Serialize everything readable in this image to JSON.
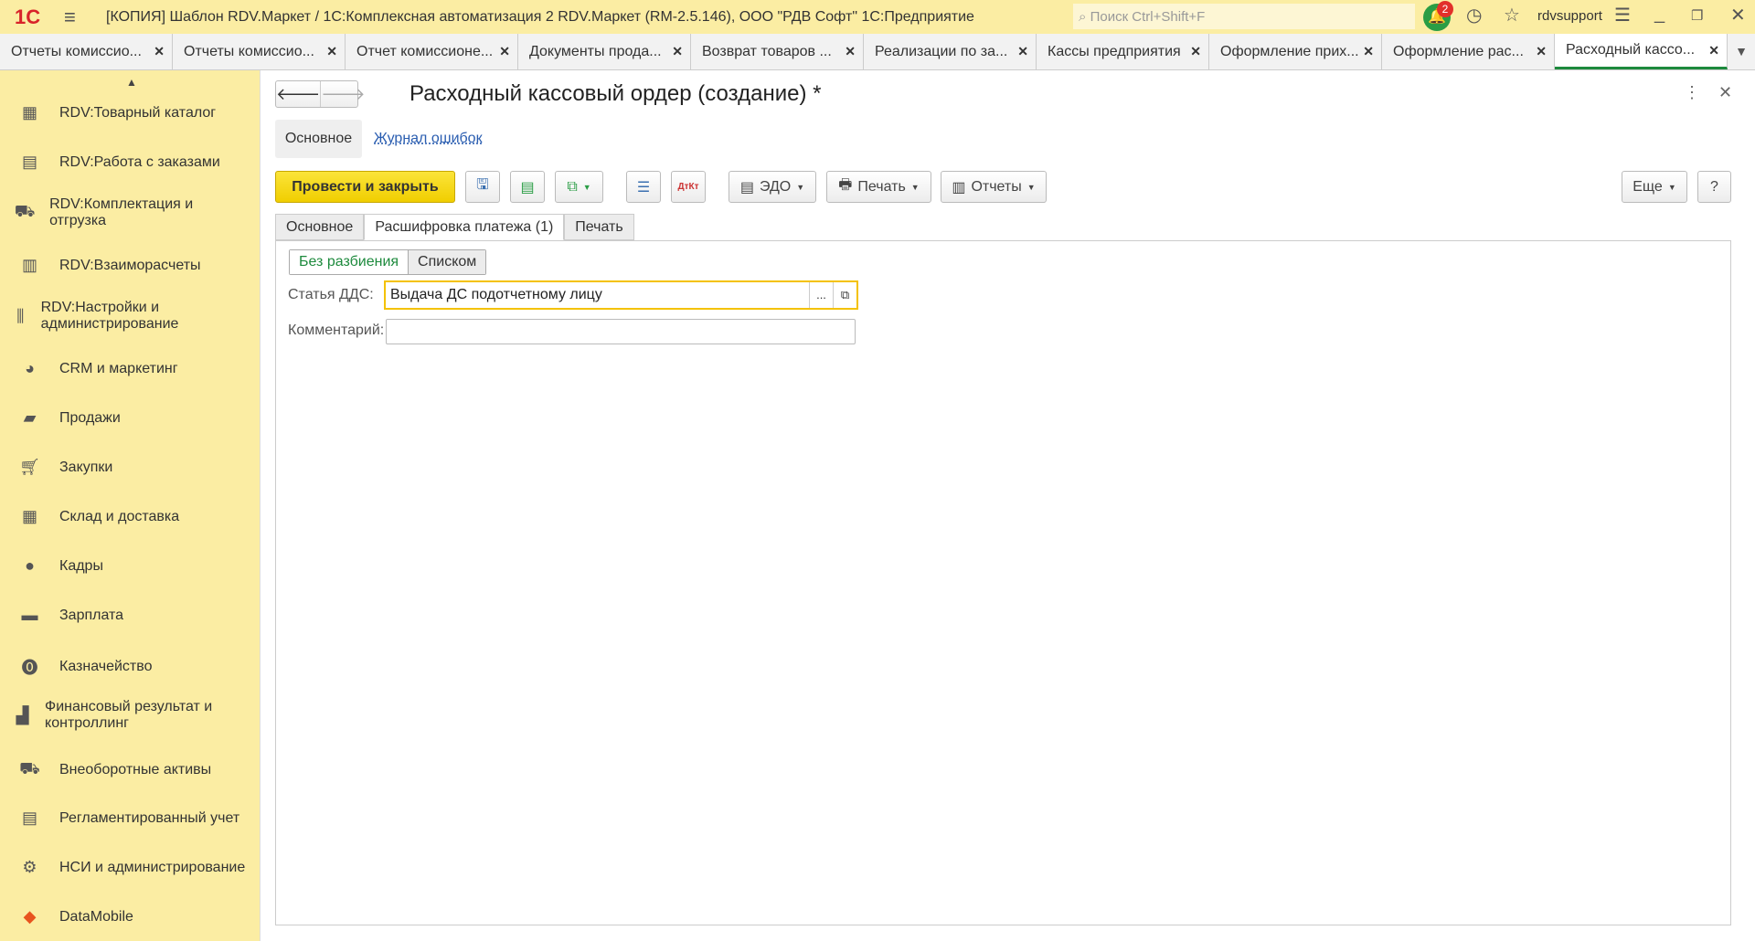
{
  "titlebar": {
    "logo": "1С",
    "title": "[КОПИЯ] Шаблон RDV.Маркет / 1С:Комплексная автоматизация 2 RDV.Маркет (RM-2.5.146), ООО \"РДВ Софт\" 1С:Предприятие",
    "search_placeholder": "Поиск Ctrl+Shift+F",
    "notifications": "2",
    "user": "rdvsupport"
  },
  "open_tabs": [
    "Отчеты комиссио...",
    "Отчеты комиссио...",
    "Отчет комиссионе...",
    "Документы прода...",
    "Возврат товаров ...",
    "Реализации по за...",
    "Кассы предприятия",
    "Оформление прих...",
    "Оформление рас...",
    "Расходный кассо..."
  ],
  "sidebar": [
    "RDV:Товарный каталог",
    "RDV:Работа с заказами",
    "RDV:Комплектация и отгрузка",
    "RDV:Взаиморасчеты",
    "RDV:Настройки и администрирование",
    "CRM и маркетинг",
    "Продажи",
    "Закупки",
    "Склад и доставка",
    "Кадры",
    "Зарплата",
    "Казначейство",
    "Финансовый результат и контроллинг",
    "Внеоборотные активы",
    "Регламентированный учет",
    "НСИ и администрирование",
    "DataMobile"
  ],
  "form": {
    "title": "Расходный кассовый ордер (создание) *",
    "nav_main": "Основное",
    "nav_errors": "Журнал ошибок",
    "toolbar": {
      "post_close": "Провести и закрыть",
      "edo": "ЭДО",
      "print": "Печать",
      "reports": "Отчеты",
      "more": "Еще",
      "help": "?",
      "dtkt": "ДтКт"
    },
    "tabs": [
      "Основное",
      "Расшифровка платежа (1)",
      "Печать"
    ],
    "toggle": [
      "Без разбиения",
      "Списком"
    ],
    "dds_label": "Статья ДДС:",
    "dds_value": "Выдача ДС подотчетному лицу",
    "dots": "...",
    "comment_label": "Комментарий:",
    "comment_value": ""
  }
}
